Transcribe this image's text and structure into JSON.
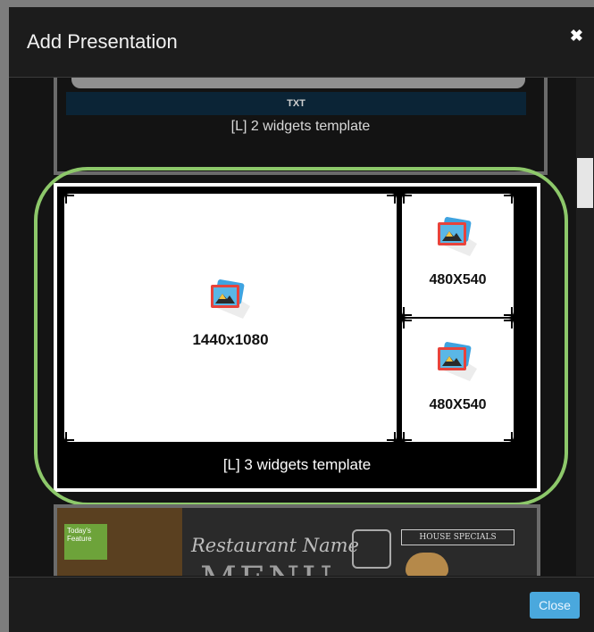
{
  "dialog": {
    "title": "Add Presentation",
    "close_icon": "close-icon"
  },
  "templates": [
    {
      "txt_label": "TXT",
      "name": "[L] 2 widgets template"
    },
    {
      "name": "[L] 3 widgets template",
      "widgets": [
        {
          "size": "1440x1080",
          "icon": "image-icon"
        },
        {
          "size": "480X540",
          "icon": "image-icon"
        },
        {
          "size": "480X540",
          "icon": "image-icon"
        }
      ]
    },
    {
      "feature": "Today's Feature",
      "restaurant": "Restaurant Name",
      "menu": "MENU",
      "specials": "HOUSE SPECIALS"
    }
  ],
  "footer": {
    "close_label": "Close"
  },
  "colors": {
    "highlight": "#8dc86a",
    "button": "#4aa8dd"
  }
}
